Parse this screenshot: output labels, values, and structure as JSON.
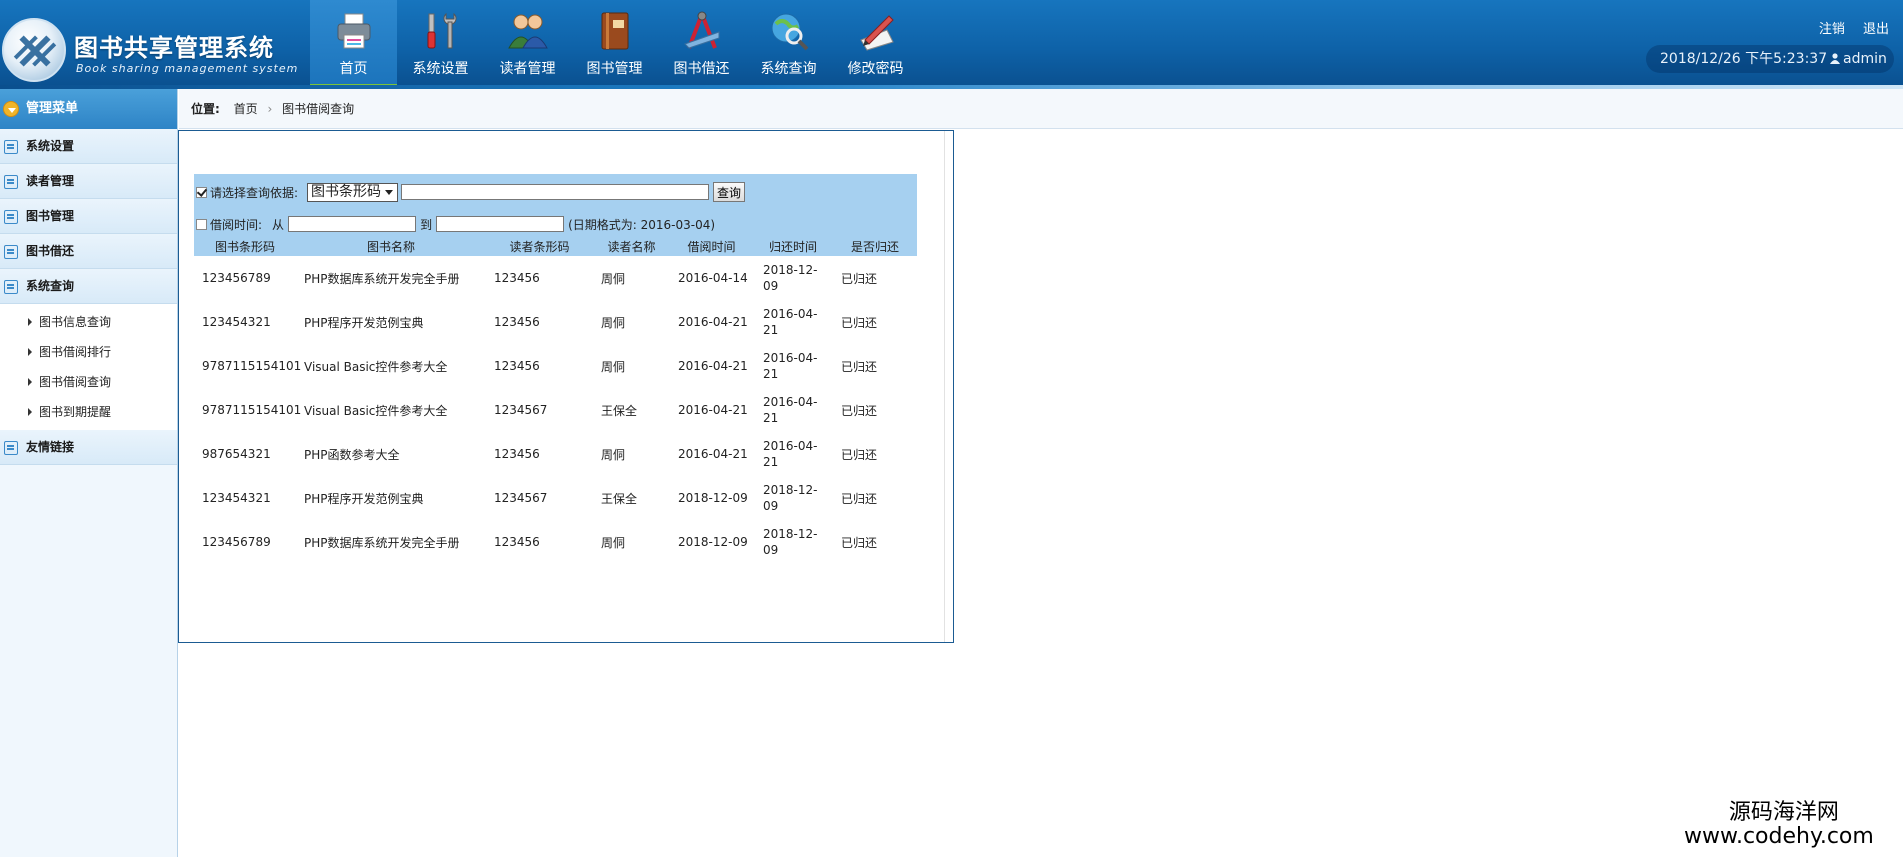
{
  "header": {
    "title": "图书共享管理系统",
    "subtitle": "Book sharing management system",
    "nav": [
      {
        "label": "首页",
        "icon": "printer-icon"
      },
      {
        "label": "系统设置",
        "icon": "tools-icon"
      },
      {
        "label": "读者管理",
        "icon": "users-icon"
      },
      {
        "label": "图书管理",
        "icon": "book-icon"
      },
      {
        "label": "图书借还",
        "icon": "drafting-icon"
      },
      {
        "label": "系统查询",
        "icon": "globe-search-icon"
      },
      {
        "label": "修改密码",
        "icon": "pen-icon"
      }
    ],
    "active_nav": 0,
    "links": {
      "logout": "注销",
      "exit": "退出"
    },
    "datetime": "2018/12/26 下午5:23:37",
    "user": "admin"
  },
  "sidebar": {
    "head": "管理菜单",
    "groups": [
      "系统设置",
      "读者管理",
      "图书管理",
      "图书借还",
      "系统查询"
    ],
    "sub_items": [
      "图书信息查询",
      "图书借阅排行",
      "图书借阅查询",
      "图书到期提醒"
    ],
    "last_group": "友情链接"
  },
  "breadcrumb": {
    "label": "位置:",
    "home": "首页",
    "current": "图书借阅查询"
  },
  "search": {
    "criteria_label": "请选择查询依据:",
    "criteria_value": "图书条形码",
    "query_button": "查询",
    "date_label": "借阅时间:",
    "from_label": "从",
    "to_label": "到",
    "format_hint": "(日期格式为: 2016-03-04)"
  },
  "table": {
    "headers": [
      "图书条形码",
      "图书名称",
      "读者条形码",
      "读者名称",
      "借阅时间",
      "归还时间",
      "是否归还"
    ],
    "rows": [
      [
        "123456789",
        "PHP数据库系统开发完全手册",
        "123456",
        "周侗",
        "2016-04-14",
        "2018-12-09",
        "已归还"
      ],
      [
        "123454321",
        "PHP程序开发范例宝典",
        "123456",
        "周侗",
        "2016-04-21",
        "2016-04-21",
        "已归还"
      ],
      [
        "9787115154101",
        "Visual Basic控件参考大全",
        "123456",
        "周侗",
        "2016-04-21",
        "2016-04-21",
        "已归还"
      ],
      [
        "9787115154101",
        "Visual Basic控件参考大全",
        "1234567",
        "王保全",
        "2016-04-21",
        "2016-04-21",
        "已归还"
      ],
      [
        "987654321",
        "PHP函数参考大全",
        "123456",
        "周侗",
        "2016-04-21",
        "2016-04-21",
        "已归还"
      ],
      [
        "123454321",
        "PHP程序开发范例宝典",
        "1234567",
        "王保全",
        "2018-12-09",
        "2018-12-09",
        "已归还"
      ],
      [
        "123456789",
        "PHP数据库系统开发完全手册",
        "123456",
        "周侗",
        "2018-12-09",
        "2018-12-09",
        "已归还"
      ]
    ]
  },
  "watermark": {
    "line1": "源码海洋网",
    "line2": "www.codehy.com"
  },
  "colors": {
    "header": "#0e62a8",
    "accent_bar": "#7bc43a",
    "panel": "#a6d0f0",
    "sidebar": "#f0f7fd"
  }
}
